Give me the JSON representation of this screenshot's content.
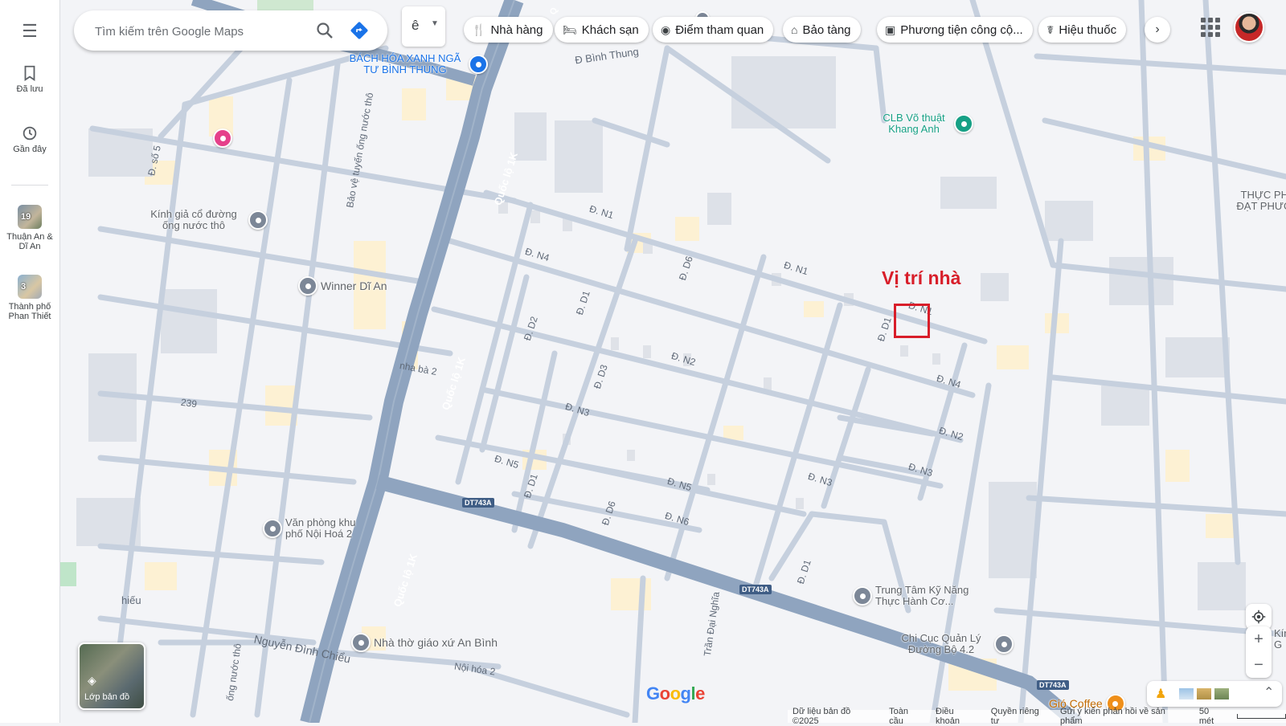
{
  "colors": {
    "highway": "#8fa4bf",
    "street": "#c9d3e1",
    "building": "#dfe2e8",
    "block_yellow": "#fdf1d3",
    "annotation": "#d81e2a",
    "pin_gray": "#7c8797",
    "pin_green": "#16a085",
    "pin_pink": "#e5408a",
    "pin_blue": "#1a73e8",
    "pin_orange": "#ef8f1a"
  },
  "rail": {
    "menu_icon": "menu-icon",
    "saved": {
      "label": "Đã lưu",
      "icon": "bookmark-icon"
    },
    "recent": {
      "label": "Gần đây",
      "icon": "history-icon"
    },
    "place1": {
      "badge": "19",
      "label": "Thuận An & Dĩ An"
    },
    "place2": {
      "badge": "3",
      "label": "Thành phố Phan Thiết"
    }
  },
  "search": {
    "placeholder": "Tìm kiếm trên Google Maps",
    "ime_char": "ê"
  },
  "chips": [
    {
      "label": "Nhà hàng",
      "icon": "fork-knife-icon"
    },
    {
      "label": "Khách sạn",
      "icon": "bed-icon"
    },
    {
      "label": "Điểm tham quan",
      "icon": "camera-icon"
    },
    {
      "label": "Bảo tàng",
      "icon": "museum-icon"
    },
    {
      "label": "Phương tiện công cộ...",
      "icon": "train-icon"
    },
    {
      "label": "Hiệu thuốc",
      "icon": "pharmacy-icon"
    }
  ],
  "annotation": {
    "text": "Vị trí nhà"
  },
  "roads": {
    "ql1k": "Quốc lộ 1K",
    "dt743a": "DT743A",
    "binh_thung": "Đ Bình Thung",
    "n1": "Đ. N1",
    "n2": "Đ. N2",
    "n3": "Đ. N3",
    "n4": "Đ. N4",
    "n5": "Đ. N5",
    "n6": "Đ. N6",
    "d1": "Đ. D1",
    "d2": "Đ. D2",
    "d3": "Đ. D3",
    "d6": "Đ. D6",
    "so5": "Đ. số 5",
    "bao_ve": "Bảo vệ tuyến ống nước thô",
    "nha_ba_2": "nha bà 2",
    "n239": "239",
    "tran_dai_nghia": "Trần Đại Nghĩa",
    "nguyen_dinh_chieu": "Nguyễn Đình Chiểu",
    "noi_hoa_2": "Nội hóa 2",
    "ong_nuoc_tho": "ống nước thô",
    "hieu": "hiếu"
  },
  "pois": [
    {
      "name": "BÁCH HÓA XANH NGÃ TƯ BÌNH THUNG",
      "icon": "cart-icon"
    },
    {
      "name": "CLB Võ thuật Khang Anh",
      "icon": "place-icon"
    },
    {
      "name": "THỰC PHẨM ĐẠT PHƯƠNG",
      "icon": "place-icon"
    },
    {
      "name": "Kính giả cổ đường ống nước thô",
      "icon": "place-icon"
    },
    {
      "name": "Winner Dĩ An",
      "icon": "place-icon"
    },
    {
      "name": "Văn phòng khu phố Nội Hoá 2",
      "icon": "place-icon"
    },
    {
      "name": "Trung Tâm Kỹ Năng Thực Hành Cơ...",
      "icon": "place-icon"
    },
    {
      "name": "Chi Cục Quản Lý Đường Bộ 4.2",
      "icon": "government-icon"
    },
    {
      "name": "Nhà thờ giáo xứ An Bình",
      "icon": "church-icon"
    },
    {
      "name": "Gió Coffee",
      "icon": "coffee-icon"
    },
    {
      "name": "Kính c... (HL... G",
      "icon": "place-icon"
    }
  ],
  "controls": {
    "layers_label": "Lớp bản đồ",
    "zoom_in": "+",
    "zoom_out": "−",
    "brand": "Google"
  },
  "footer": {
    "map_data": "Dữ liệu bản đồ ©2025",
    "global": "Toàn cầu",
    "terms": "Điều khoản",
    "privacy": "Quyền riêng tư",
    "feedback": "Gửi ý kiến phản hồi về sản phẩm",
    "scale": "50 mét"
  }
}
